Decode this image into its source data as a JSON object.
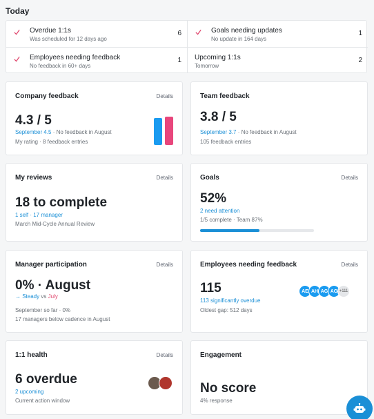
{
  "section_title": "Today",
  "today": [
    {
      "title": "Overdue 1:1s",
      "subtitle": "Was scheduled for 12 days ago",
      "count": "6",
      "checked": true
    },
    {
      "title": "Goals needing updates",
      "subtitle": "No update in 164 days",
      "count": "1",
      "checked": true
    },
    {
      "title": "Employees needing feedback",
      "subtitle": "No feedback in 60+ days",
      "count": "1",
      "checked": true
    },
    {
      "title": "Upcoming 1:1s",
      "subtitle": "Tomorrow",
      "count": "2",
      "checked": false
    }
  ],
  "details_label": "Details",
  "company_feedback": {
    "title": "Company feedback",
    "value": "4.3 / 5",
    "sub_highlight": "September 4.5",
    "sub_rest": " · No feedback in August",
    "note": "My rating · 8 feedback entries",
    "bars": [
      {
        "value": 4.3,
        "color": "#1a9bf0"
      },
      {
        "value": 4.5,
        "color": "#e8467c"
      }
    ]
  },
  "team_feedback": {
    "title": "Team feedback",
    "value": "3.8 / 5",
    "sub_highlight": "September 3.7",
    "sub_rest": " · No feedback in August",
    "note": "105 feedback entries"
  },
  "my_reviews": {
    "title": "My reviews",
    "value": "18 to complete",
    "sub": "1 self · 17 manager",
    "note": "March Mid-Cycle Annual Review"
  },
  "goals": {
    "title": "Goals",
    "value": "52%",
    "sub": "2 need attention",
    "note": "1/5 complete · Team 87%",
    "progress": 0.52
  },
  "manager_participation": {
    "title": "Manager participation",
    "value": "0% · August",
    "sub_arrow": "→ Steady",
    "sub_vs": " vs ",
    "sub_month": "July",
    "note1": "September so far · 0%",
    "note2": "17 managers below cadence in August"
  },
  "employees_feedback": {
    "title": "Employees needing feedback",
    "value": "115",
    "sub": "113 significantly overdue",
    "note": "Oldest gap: 512 days",
    "avatars": [
      "AE",
      "AH",
      "AG",
      "AG"
    ],
    "more": "+111",
    "avatar_color": "#1a9bf0"
  },
  "one_on_one": {
    "title": "1:1 health",
    "value": "6 overdue",
    "sub": "2 upcoming",
    "note": "Current action window"
  },
  "engagement": {
    "title": "Engagement",
    "value": "No score",
    "note": "4% response"
  },
  "colors": {
    "accent": "#1a8fd6",
    "check": "#e0486e"
  }
}
